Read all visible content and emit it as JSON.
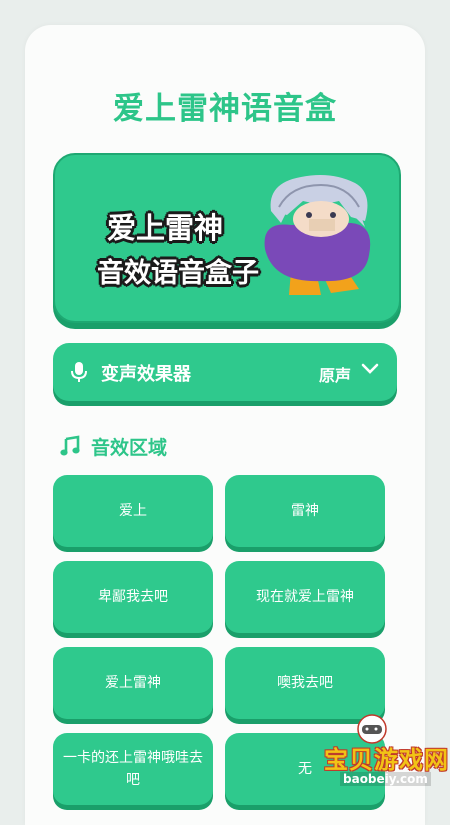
{
  "app": {
    "title": "爱上雷神语音盒"
  },
  "banner": {
    "line1": "爱上雷神",
    "line2": "音效语音盒子",
    "pattern": "ﾞﾞﾞﾞﾞﾞﾞﾞﾞﾞﾞﾞﾞﾞﾞﾞﾞﾞﾞﾞﾞﾞﾞﾞﾞﾞﾞﾞﾞﾞﾞﾞ"
  },
  "voice_changer": {
    "label": "变声效果器",
    "selected": "原声",
    "icon": "microphone-icon"
  },
  "section": {
    "title": "音效区域",
    "icon": "music-note-icon"
  },
  "sounds": [
    "爱上",
    "雷神",
    "卑鄙我去吧",
    "现在就爱上雷神",
    "爱上雷神",
    "噢我去吧",
    "一卡的还上雷神哦哇去吧",
    "无"
  ],
  "watermark": {
    "text": "宝贝游戏网",
    "url": "baobeiy.com"
  },
  "colors": {
    "accent": "#2fc98d",
    "accent_dark": "#1a9f6a",
    "watermark": "#f2c316"
  }
}
